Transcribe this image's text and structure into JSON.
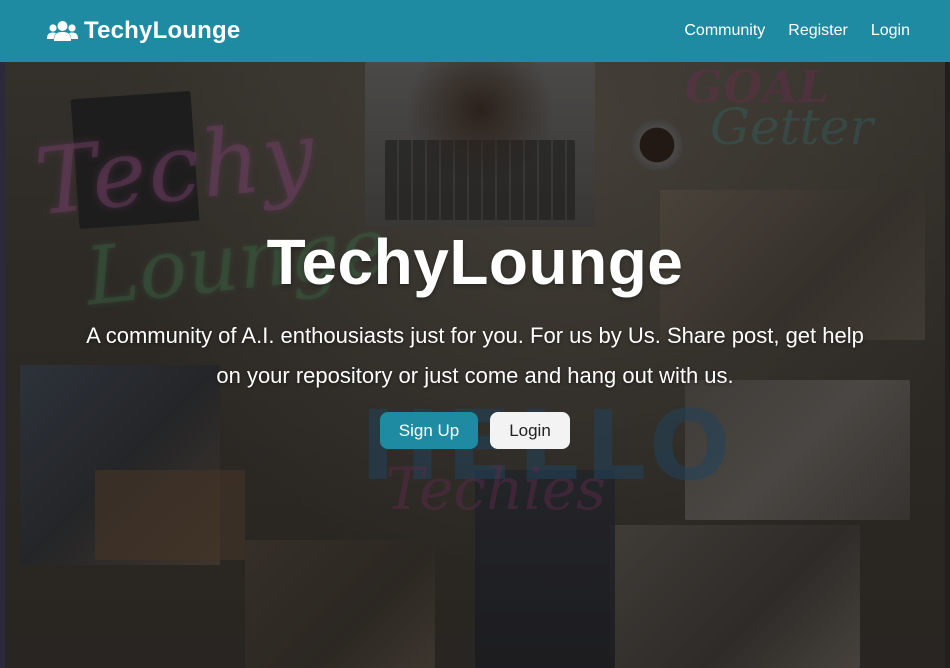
{
  "navbar": {
    "brand": "TechyLounge",
    "brand_icon": "users-icon",
    "links": [
      "Community",
      "Register",
      "Login"
    ]
  },
  "hero": {
    "title": "TechyLounge",
    "description": "A community of A.I. enthousiasts just for you. For us by Us. Share post, get help on your repository or just come and hang out with us.",
    "buttons": {
      "signup": "Sign Up",
      "login": "Login"
    }
  },
  "background_signs": {
    "techy": "Techy",
    "lounge": "Lounge",
    "goal": "GOAL",
    "getter": "Getter",
    "hello": "HELLO",
    "techies": "Techies"
  },
  "colors": {
    "brand_teal": "#1f8ba2",
    "text_light": "#ffffff",
    "button_light": "#f3f3f3"
  }
}
